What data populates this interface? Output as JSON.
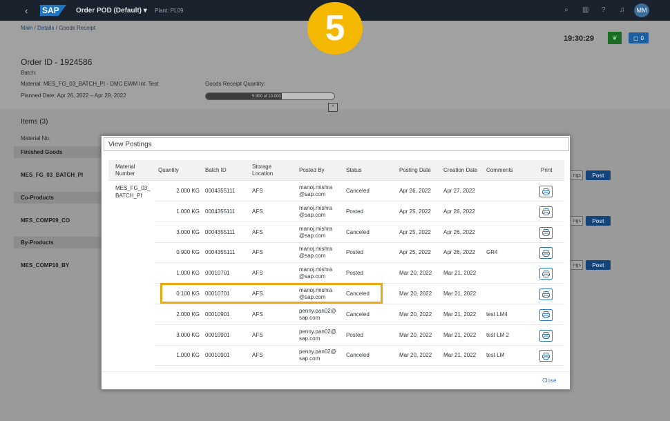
{
  "shell": {
    "app_title": "Order POD (Default) ▾",
    "plant": "Plant: PL09",
    "logo": "SAP",
    "user_initials": "MM"
  },
  "step_number": "5",
  "breadcrumb": {
    "main": "Main",
    "sep1": "/",
    "details": "Details",
    "sep2": "/",
    "current": "Goods Receipt"
  },
  "clock": "19:30:29",
  "notifications_count": "0",
  "order": {
    "title": "Order ID - 1924586",
    "batch": "Batch:",
    "material": "Material: MES_FG_03_BATCH_PI - DMC EWM Int. Test",
    "planned_date": "Planned Date: Apr 26, 2022 – Apr 29, 2022",
    "grq_label": "Goods Receipt Quantity:",
    "grq_text": "5.900 of 10.000 KG",
    "grq_fraction": 0.59
  },
  "items": {
    "title": "Items (3)",
    "col_material_no": "Material No.",
    "groups": [
      {
        "label": "Finished Goods",
        "material": "MES_FG_03_BATCH_PI"
      },
      {
        "label": "Co-Products",
        "material": "MES_COMP09_CO"
      },
      {
        "label": "By-Products",
        "material": "MES_COMP10_BY"
      }
    ],
    "settings_fragment": "ngs",
    "post_label": "Post"
  },
  "dialog": {
    "title": "View Postings",
    "columns": {
      "material_number": "Material Number",
      "quantity": "Quantity",
      "batch_id": "Batch ID",
      "storage_location": "Storage Location",
      "posted_by": "Posted By",
      "status": "Status",
      "posting_date": "Posting Date",
      "creation_date": "Creation Date",
      "comments": "Comments",
      "print": "Print"
    },
    "material": "MES_FG_03_BATCH_PI",
    "rows": [
      {
        "qty": "2.000 KG",
        "batch": "0004355111",
        "loc": "AFS",
        "by1": "manoj.mishra",
        "by2": "@sap.com",
        "status": "Canceled",
        "posting": "Apr 26, 2022",
        "creation": "Apr 27, 2022",
        "comment": ""
      },
      {
        "qty": "1.000 KG",
        "batch": "0004355111",
        "loc": "AFS",
        "by1": "manoj.mishra",
        "by2": "@sap.com",
        "status": "Posted",
        "posting": "Apr 25, 2022",
        "creation": "Apr 26, 2022",
        "comment": ""
      },
      {
        "qty": "3.000 KG",
        "batch": "0004355111",
        "loc": "AFS",
        "by1": "manoj.mishra",
        "by2": "@sap.com",
        "status": "Canceled",
        "posting": "Apr 25, 2022",
        "creation": "Apr 26, 2022",
        "comment": ""
      },
      {
        "qty": "0.900 KG",
        "batch": "0004355111",
        "loc": "AFS",
        "by1": "manoj.mishra",
        "by2": "@sap.com",
        "status": "Posted",
        "posting": "Apr 25, 2022",
        "creation": "Apr 26, 2022",
        "comment": "GR4"
      },
      {
        "qty": "1.000 KG",
        "batch": "00010701",
        "loc": "AFS",
        "by1": "manoj.mishra",
        "by2": "@sap.com",
        "status": "Posted",
        "posting": "Mar 20, 2022",
        "creation": "Mar 21, 2022",
        "comment": ""
      },
      {
        "qty": "0.100 KG",
        "batch": "00010701",
        "loc": "AFS",
        "by1": "manoj.mishra",
        "by2": "@sap.com",
        "status": "Canceled",
        "posting": "Mar 20, 2022",
        "creation": "Mar 21, 2022",
        "comment": ""
      },
      {
        "qty": "2.000 KG",
        "batch": "00010901",
        "loc": "AFS",
        "by1": "penny.pan02@",
        "by2": "sap.com",
        "status": "Canceled",
        "posting": "Mar 20, 2022",
        "creation": "Mar 21, 2022",
        "comment": "test LM4"
      },
      {
        "qty": "3.000 KG",
        "batch": "00010901",
        "loc": "AFS",
        "by1": "penny.pan02@",
        "by2": "sap.com",
        "status": "Posted",
        "posting": "Mar 20, 2022",
        "creation": "Mar 21, 2022",
        "comment": "test LM 2"
      },
      {
        "qty": "1.000 KG",
        "batch": "00010901",
        "loc": "AFS",
        "by1": "penny.pan02@",
        "by2": "sap.com",
        "status": "Canceled",
        "posting": "Mar 20, 2022",
        "creation": "Mar 21, 2022",
        "comment": "test LM"
      }
    ],
    "close_label": "Close"
  },
  "colors": {
    "shell": "#1a232d",
    "accent": "#2e7bc4",
    "highlight": "#eaa912",
    "badge": "#f5b800"
  }
}
